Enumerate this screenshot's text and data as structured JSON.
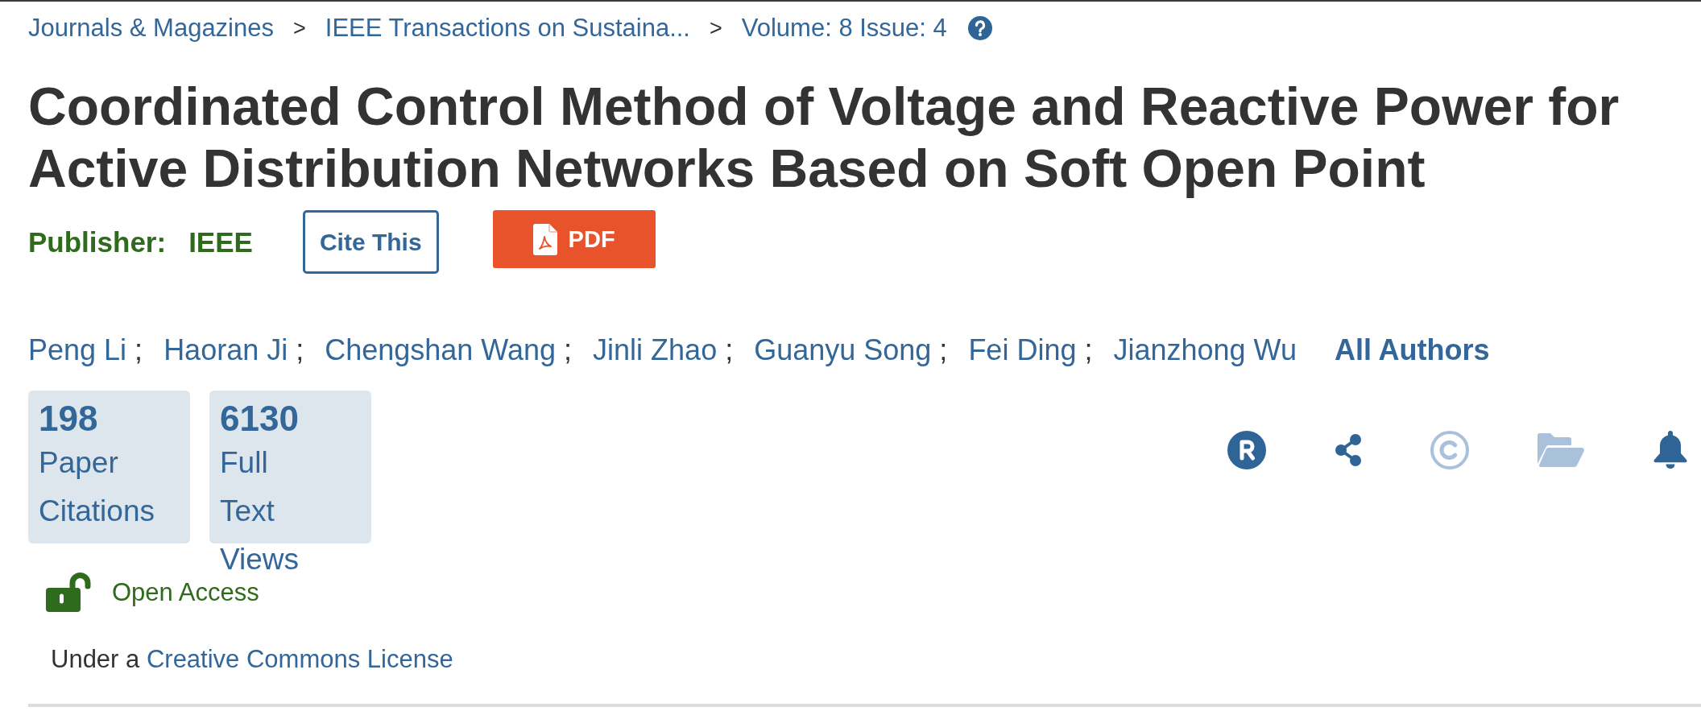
{
  "breadcrumb": {
    "items": [
      {
        "label": "Journals & Magazines",
        "separator": ">"
      },
      {
        "label": "IEEE Transactions on Sustaina...",
        "separator": ">"
      },
      {
        "label": "Volume: 8 Issue: 4"
      }
    ]
  },
  "title": "Coordinated Control Method of Voltage and Reactive Power for Active Distribution Networks Based on Soft Open Point",
  "publisher": {
    "label": "Publisher:",
    "value": "IEEE"
  },
  "buttons": [
    {
      "kind": "cite",
      "label": "Cite This"
    },
    {
      "kind": "pdf",
      "label": "PDF"
    }
  ],
  "authors": {
    "items": [
      {
        "name": "Peng Li",
        "separator": ";"
      },
      {
        "name": "Haoran Ji",
        "separator": ";"
      },
      {
        "name": "Chengshan Wang",
        "separator": ";"
      },
      {
        "name": "Jinli Zhao",
        "separator": ";"
      },
      {
        "name": "Guanyu Song",
        "separator": ";"
      },
      {
        "name": "Fei Ding",
        "separator": ";"
      },
      {
        "name": "Jianzhong Wu"
      }
    ],
    "all_authors": "All Authors"
  },
  "metrics": [
    {
      "count": "198",
      "label": "Paper Citations"
    },
    {
      "count": "6130",
      "label": "Full Text Views"
    }
  ],
  "actions": [
    {
      "kind": "rights",
      "disabled": false
    },
    {
      "kind": "share",
      "disabled": false
    },
    {
      "kind": "copyright",
      "disabled": true
    },
    {
      "kind": "folder",
      "disabled": true
    },
    {
      "kind": "alert",
      "disabled": false
    }
  ],
  "access": {
    "label": "Open Access"
  },
  "license": {
    "text": "Under a",
    "link": "Creative Commons License"
  }
}
